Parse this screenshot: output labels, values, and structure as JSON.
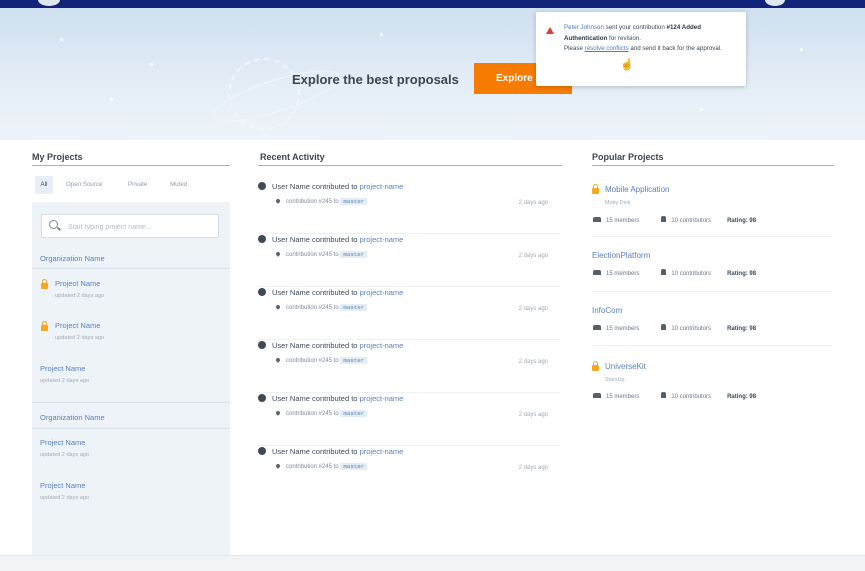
{
  "hero": {
    "title": "Explore the best proposals",
    "button_label": "Explore Jo"
  },
  "notification": {
    "user": "Peter Johnson",
    "text1": " sent your contribution ",
    "contribution": "#124 Added Authentication",
    "text2": " for revision.",
    "text3": "Please ",
    "link": "resolve conflicts",
    "text4": " and send it back for the approval."
  },
  "my_projects": {
    "title": "My Projects",
    "tabs": [
      "All",
      "Open Source",
      "Private",
      "Muted"
    ],
    "search_placeholder": "Start typing project name...",
    "org1": "Organization Name",
    "org2": "Organization Name",
    "projects": [
      {
        "name": "Project Name",
        "updated": "updated 2 days ago"
      },
      {
        "name": "Project Name",
        "updated": "updated 2 days ago"
      },
      {
        "name": "Project Name",
        "updated": "updated 2 days ago"
      },
      {
        "name": "Project Name",
        "updated": "updated 2 days ago"
      },
      {
        "name": "Project Name",
        "updated": "updated 2 days ago"
      }
    ]
  },
  "recent_activity": {
    "title": "Recent Activity",
    "items": [
      {
        "user": "User Name",
        "action": " contributed to ",
        "project": "project-name",
        "contribution": "contribution #245 to ",
        "branch": "master",
        "time": "2 days ago"
      },
      {
        "user": "User Name",
        "action": " contributed to ",
        "project": "project-name",
        "contribution": "contribution #245 to ",
        "branch": "master",
        "time": "2 days ago"
      },
      {
        "user": "User Name",
        "action": " contributed to ",
        "project": "project-name",
        "contribution": "contribution #245 to ",
        "branch": "master",
        "time": "2 days ago"
      },
      {
        "user": "User Name",
        "action": " contributed to ",
        "project": "project-name",
        "contribution": "contribution #245 to ",
        "branch": "master",
        "time": "2 days ago"
      },
      {
        "user": "User Name",
        "action": " contributed to ",
        "project": "project-name",
        "contribution": "contribution #245 to ",
        "branch": "master",
        "time": "2 days ago"
      },
      {
        "user": "User Name",
        "action": " contributed to ",
        "project": "project-name",
        "contribution": "contribution #245 to ",
        "branch": "master",
        "time": "2 days ago"
      }
    ]
  },
  "popular_projects": {
    "title": "Popular Projects",
    "items": [
      {
        "name": "Mobile Application",
        "sub": "Moby Dick",
        "members": "15 members",
        "contributors": "10 contributors",
        "rating": "Rating: 98"
      },
      {
        "name": "ElectionPlatform",
        "sub": "",
        "members": "15 members",
        "contributors": "10 contributors",
        "rating": "Rating: 98"
      },
      {
        "name": "InfoCom",
        "sub": "",
        "members": "15 members",
        "contributors": "10 contributors",
        "rating": "Rating: 98"
      },
      {
        "name": "UniverseKit",
        "sub": "StarsUp",
        "members": "15 members",
        "contributors": "10 contributors",
        "rating": "Rating: 98"
      }
    ]
  },
  "colors": {
    "topbar": "#12237a",
    "accent": "#f57c00",
    "link": "#5b82b5",
    "lock": "#f5a623",
    "warning": "#e53935"
  }
}
